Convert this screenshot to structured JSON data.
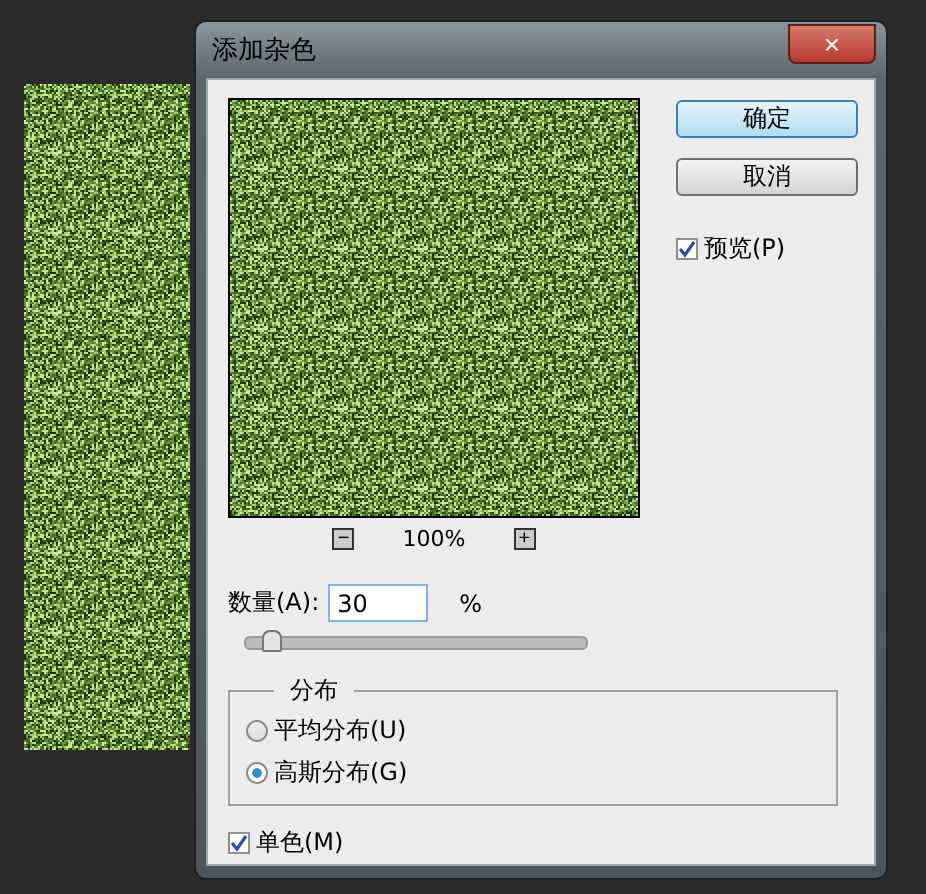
{
  "window": {
    "title": "添加杂色",
    "close": "×"
  },
  "preview": {
    "zoom_out": "−",
    "zoom": "100%",
    "zoom_in": "+"
  },
  "buttons": [
    {
      "label": "确定",
      "default": true
    },
    {
      "label": "取消",
      "default": false
    }
  ],
  "preview_toggle": {
    "label": "预览(P)",
    "checked": true
  },
  "amount": {
    "label": "数量(A):",
    "value": "30",
    "unit": "%",
    "level": 0.075
  },
  "distribution": {
    "title": "分布",
    "options": [
      {
        "label": "平均分布(U)",
        "selected": false
      },
      {
        "label": "高斯分布(G)",
        "selected": true
      }
    ]
  },
  "monochromatic": {
    "label": "单色(M)",
    "checked": true
  }
}
